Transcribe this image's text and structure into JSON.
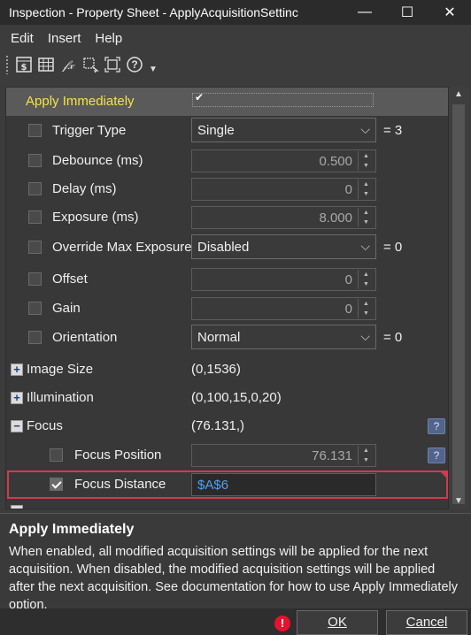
{
  "window": {
    "title": "Inspection - Property Sheet - ApplyAcquisitionSettinc",
    "minimize": "—",
    "maximize": "☐",
    "close": "✕"
  },
  "menu": [
    "Edit",
    "Insert",
    "Help"
  ],
  "toolbar": {
    "icons": [
      "dollar-sheet-icon",
      "grid-table-icon",
      "function-icon",
      "select-region-icon",
      "fit-region-icon",
      "help-circle-icon",
      "more-icon"
    ],
    "help_glyph": "?",
    "more_glyph": "▼",
    "function_glyph": "𝒻𝓍"
  },
  "grid": {
    "apply_immediately": {
      "label": "Apply Immediately",
      "checked": true,
      "tick": "✔"
    },
    "rows": [
      {
        "label": "Trigger Type",
        "value": "Single",
        "suffix": "= 3",
        "arrow": "⌵"
      },
      {
        "label": "Debounce (ms)",
        "value": "0.500"
      },
      {
        "label": "Delay (ms)",
        "value": "0"
      },
      {
        "label": "Exposure (ms)",
        "value": "8.000"
      },
      {
        "label": "Override Max Exposure",
        "value": "Disabled",
        "suffix": "= 0",
        "arrow": "⌵"
      },
      {
        "label": "Offset",
        "value": "0"
      },
      {
        "label": "Gain",
        "value": "0"
      },
      {
        "label": "Orientation",
        "value": "Normal",
        "suffix": "= 0",
        "arrow": "⌵"
      }
    ],
    "groups": [
      {
        "label": "Image Size",
        "value": "(0,1536)",
        "glyph": "+"
      },
      {
        "label": "Illumination",
        "value": "(0,100,15,0,20)",
        "glyph": "+"
      },
      {
        "label": "Focus",
        "value": "(76.131,)",
        "glyph": "−"
      }
    ],
    "focus_position": {
      "label": "Focus Position",
      "value": "76.131"
    },
    "focus_distance": {
      "label": "Focus Distance",
      "value": "$A$6",
      "checked": true
    },
    "spin_up": "▲",
    "spin_down": "▼",
    "help_glyph": "?"
  },
  "scrollbar": {
    "up": "▲",
    "down": "▼"
  },
  "help": {
    "title": "Apply Immediately",
    "description": "When enabled, all modified acquisition settings will be applied for the next acquisition. When disabled, the modified acquisition settings will be applied after the next acquisition. See documentation for how to use Apply Immediately option."
  },
  "footer": {
    "warning_glyph": "!",
    "ok": "OK",
    "cancel": "Cancel"
  },
  "colors": {
    "highlight_label": "#f5e24a",
    "formula_text": "#4f9ff2",
    "selection_border": "#d23a4e",
    "warning": "#e8112d"
  }
}
